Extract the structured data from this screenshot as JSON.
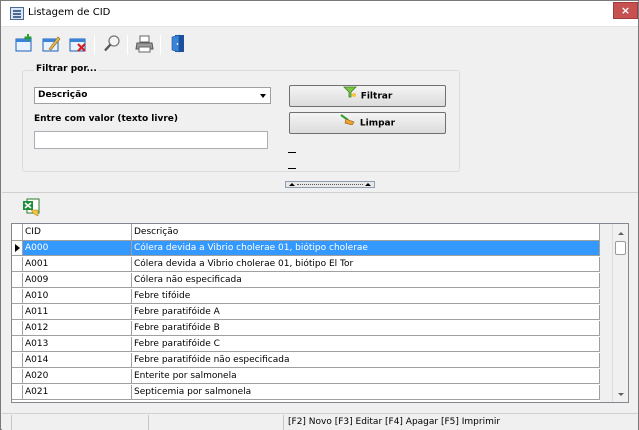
{
  "window": {
    "title": "Listagem de CID",
    "close_label": "×"
  },
  "toolbar": {
    "items": [
      {
        "name": "novo",
        "icon": "new-document-icon"
      },
      {
        "name": "editar",
        "icon": "edit-document-icon"
      },
      {
        "name": "apagar",
        "icon": "delete-document-icon"
      },
      {
        "name": "pesquisar",
        "icon": "magnifier-icon"
      },
      {
        "name": "imprimir",
        "icon": "printer-icon"
      },
      {
        "name": "sair",
        "icon": "exit-door-icon"
      }
    ]
  },
  "filter": {
    "group_label": "Filtrar por...",
    "selected_field": "Descrição",
    "value_label": "Entre com valor (texto livre)",
    "value": "",
    "filter_button": "Filtrar",
    "clear_button": "Limpar",
    "dash_1": "_",
    "dash_2": "_"
  },
  "grid": {
    "columns": [
      "CID",
      "Descrição"
    ],
    "rows": [
      {
        "cid": "A000",
        "descricao": "Cólera devida a Vibrio cholerae 01, biótipo cholerae",
        "selected": true
      },
      {
        "cid": "A001",
        "descricao": "Cólera devida a Vibrio cholerae 01, biótipo El Tor",
        "selected": false
      },
      {
        "cid": "A009",
        "descricao": "Cólera não especificada",
        "selected": false
      },
      {
        "cid": "A010",
        "descricao": "Febre tifóide",
        "selected": false
      },
      {
        "cid": "A011",
        "descricao": "Febre paratifóide A",
        "selected": false
      },
      {
        "cid": "A012",
        "descricao": "Febre paratifóide B",
        "selected": false
      },
      {
        "cid": "A013",
        "descricao": "Febre paratifóide C",
        "selected": false
      },
      {
        "cid": "A014",
        "descricao": "Febre paratifóide não especificada",
        "selected": false
      },
      {
        "cid": "A020",
        "descricao": "Enterite por salmonela",
        "selected": false
      },
      {
        "cid": "A021",
        "descricao": "Septicemia por salmonela",
        "selected": false
      }
    ]
  },
  "statusbar": {
    "shortcuts": "[F2] Novo [F3] Editar [F4] Apagar [F5] Imprimir"
  },
  "colors": {
    "selection": "#3399ff",
    "close_button": "#c75050"
  }
}
